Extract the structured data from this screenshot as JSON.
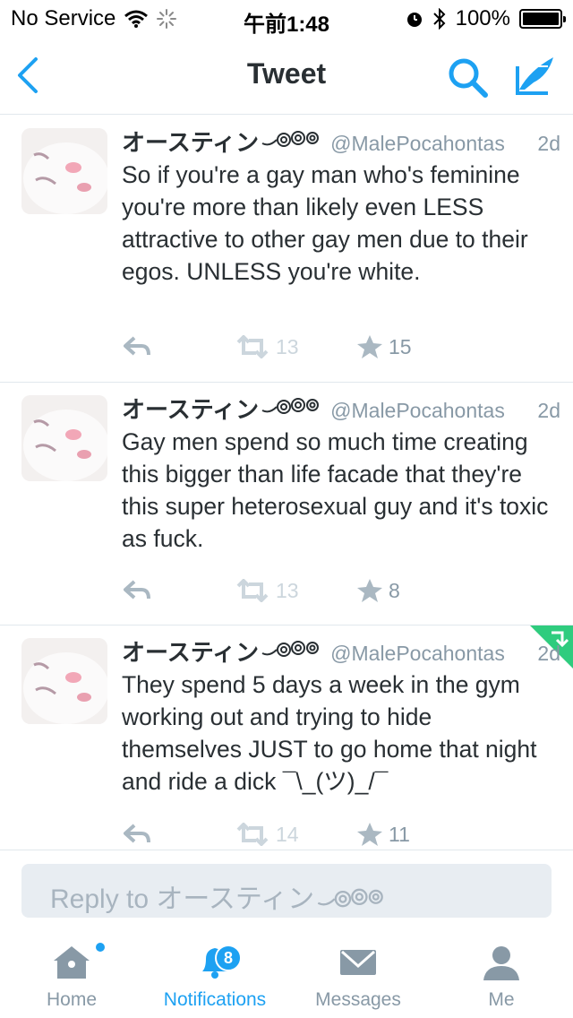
{
  "status_bar": {
    "carrier": "No Service",
    "time": "午前1:48",
    "battery": "100%"
  },
  "nav": {
    "title": "Tweet",
    "icons": [
      "back-chevron-icon",
      "search-icon",
      "compose-icon"
    ]
  },
  "tweets": [
    {
      "name": "オースティン",
      "handle": "@MalePocahontas",
      "time": "2d",
      "text": "So if you're a gay man who's feminine you're more than likely even LESS attractive to other gay men due to their egos. UNLESS you're white.",
      "retweets": "13",
      "favorites": "15"
    },
    {
      "name": "オースティン",
      "handle": "@MalePocahontas",
      "time": "2d",
      "text": "Gay men spend so much time creating this bigger than life facade that they're this super heterosexual guy and it's toxic as fuck.",
      "retweets": "13",
      "favorites": "8"
    },
    {
      "name": "オースティン",
      "handle": "@MalePocahontas",
      "time": "2d",
      "text": "They spend 5 days a week in the gym working out and trying to hide themselves JUST to go home that night and ride a dick ¯\\_(ツ)_/¯",
      "retweets": "14",
      "favorites": "11"
    }
  ],
  "reply": {
    "placeholder": "Reply to オースティン"
  },
  "tabs": [
    {
      "label": "Home",
      "icon": "home-icon"
    },
    {
      "label": "Notifications",
      "icon": "bell-icon",
      "badge": "8",
      "active": true
    },
    {
      "label": "Messages",
      "icon": "envelope-icon"
    },
    {
      "label": "Me",
      "icon": "person-icon"
    }
  ],
  "colors": {
    "accent": "#1da1f2",
    "text": "#292f33",
    "muted": "#8899a6",
    "divider": "#e1e8ed",
    "corner_badge": "#2fcc7e"
  }
}
